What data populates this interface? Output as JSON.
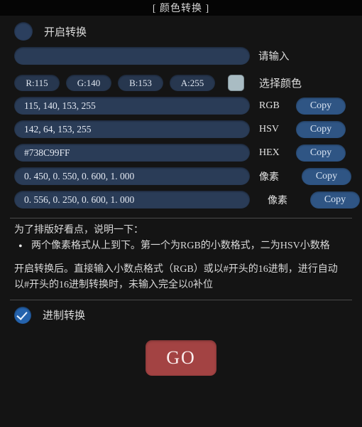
{
  "window": {
    "title": "[ 颜色转换 ]"
  },
  "enable_toggle": {
    "label": "开启转换",
    "checked": false
  },
  "main_input": {
    "value": "",
    "placeholder": "",
    "side_label": "请输入"
  },
  "channels": {
    "pills": [
      {
        "label": "R:115"
      },
      {
        "label": "G:140"
      },
      {
        "label": "B:153"
      },
      {
        "label": "A:255"
      }
    ],
    "swatch_color": "#a9bcc3",
    "swatch_label": "选择颜色"
  },
  "values": [
    {
      "value": "115, 140, 153, 255",
      "format": "RGB",
      "copy_label": "Copy",
      "indent": false
    },
    {
      "value": "142, 64, 153, 255",
      "format": "HSV",
      "copy_label": "Copy",
      "indent": false
    },
    {
      "value": "#738C99FF",
      "format": "HEX",
      "copy_label": "Copy",
      "indent": false
    },
    {
      "value": "0. 450, 0. 550, 0. 600, 1. 000",
      "format": "像素",
      "copy_label": "Copy",
      "indent": false
    },
    {
      "value": "0. 556, 0. 250, 0. 600, 1. 000",
      "format": "像素",
      "copy_label": "Copy",
      "indent": true
    }
  ],
  "notes": {
    "line1": "为了排版好看点，说明一下：",
    "bullet1": "两个像素格式从上到下。第一个为RGB的小数格式，二为HSV小数格",
    "line2": "开启转换后。直接输入小数点格式（RGB）或以#开头的16进制，进行自动",
    "line3": "以#开头的16进制转换时，未输入完全以0补位"
  },
  "radix_toggle": {
    "label": "进制转换",
    "checked": true
  },
  "go_button": {
    "label": "GO",
    "color": "#a34343"
  }
}
